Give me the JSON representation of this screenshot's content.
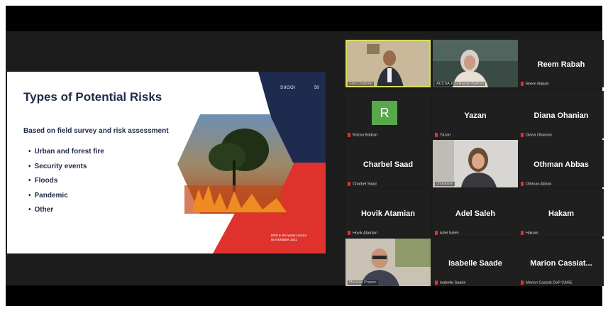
{
  "slide": {
    "title": "Types of Potential Risks",
    "subtitle": "Based on field survey and risk assessment",
    "bullets": [
      "Urban and forest fire",
      "Security events",
      "Floods",
      "Pandemic",
      "Other"
    ],
    "logo_text": "SIIGOI",
    "page_number": "50",
    "footer_line1": "DRR in the WaSH Sector",
    "footer_line2": "NOVEMBER 2021"
  },
  "participants": [
    {
      "name": "Zahi Chahine",
      "label": "Zahi Chahine",
      "video": true
    },
    {
      "name": "Razan Badran",
      "label": "ACCSA.ICU-Razan Badran",
      "video": true
    },
    {
      "name": "Reem Rabah",
      "label": "Reem Rabah",
      "video": false
    },
    {
      "name": "R",
      "label": "Razan Badran",
      "video": false,
      "avatar": "R"
    },
    {
      "name": "Yazan",
      "label": "Yazan",
      "video": false
    },
    {
      "name": "Diana Ohanian",
      "label": "Diana Ohanian",
      "video": false
    },
    {
      "name": "Charbel Saad",
      "label": "Charbel Saad",
      "video": false
    },
    {
      "name": "Christiane",
      "label": "christiane",
      "video": true
    },
    {
      "name": "Othman Abbas",
      "label": "Othman Abbas",
      "video": false
    },
    {
      "name": "Hovik Atamian",
      "label": "Hovik Atamian",
      "video": false
    },
    {
      "name": "Adel Saleh",
      "label": "Adel Saleh",
      "video": false
    },
    {
      "name": "Hakam",
      "label": "Hakam",
      "video": false
    },
    {
      "name": "Marwan Prazen",
      "label": "Marwan Prazen",
      "video": true
    },
    {
      "name": "Isabelle Saade",
      "label": "Isabelle Saade",
      "video": false
    },
    {
      "name": "Marion Cassiat...",
      "label": "Marion Cassiat DoP CARE",
      "video": false
    }
  ],
  "colors": {
    "navy": "#1e2a4e",
    "red": "#e0322d",
    "active_border": "#d6e05b",
    "avatar_green": "#5aa84c"
  }
}
